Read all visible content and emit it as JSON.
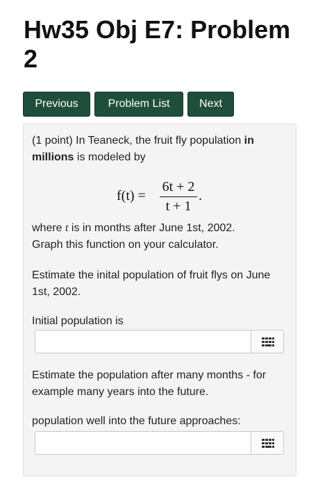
{
  "page": {
    "title": "Hw35 Obj E7: Problem 2"
  },
  "nav": {
    "previous": "Previous",
    "problem_list": "Problem List",
    "next": "Next"
  },
  "problem": {
    "intro_points": "(1 point) In Teaneck, the fruit fly population ",
    "intro_bold": "in millions",
    "intro_rest": " is modeled by",
    "formula": {
      "lhs": "f(t) =",
      "numerator": "6t + 2",
      "denominator": "t + 1",
      "end": "."
    },
    "where_a": "where ",
    "where_var": "t",
    "where_b": " is in months after June 1st, 2002.",
    "graph_text": "Graph this function on your calculator.",
    "q1_text": "Estimate the inital population of fruit flys on June 1st, 2002.",
    "q1_label": "Initial population is",
    "q1_value": "",
    "q2_text": "Estimate the population after many months - for example many years into the future.",
    "q2_label": "population well into the future approaches:",
    "q2_value": ""
  },
  "icons": {
    "keypad": "keypad-icon"
  },
  "colors": {
    "button_bg": "#1f4e3d",
    "panel_bg": "#f4f4f4"
  }
}
